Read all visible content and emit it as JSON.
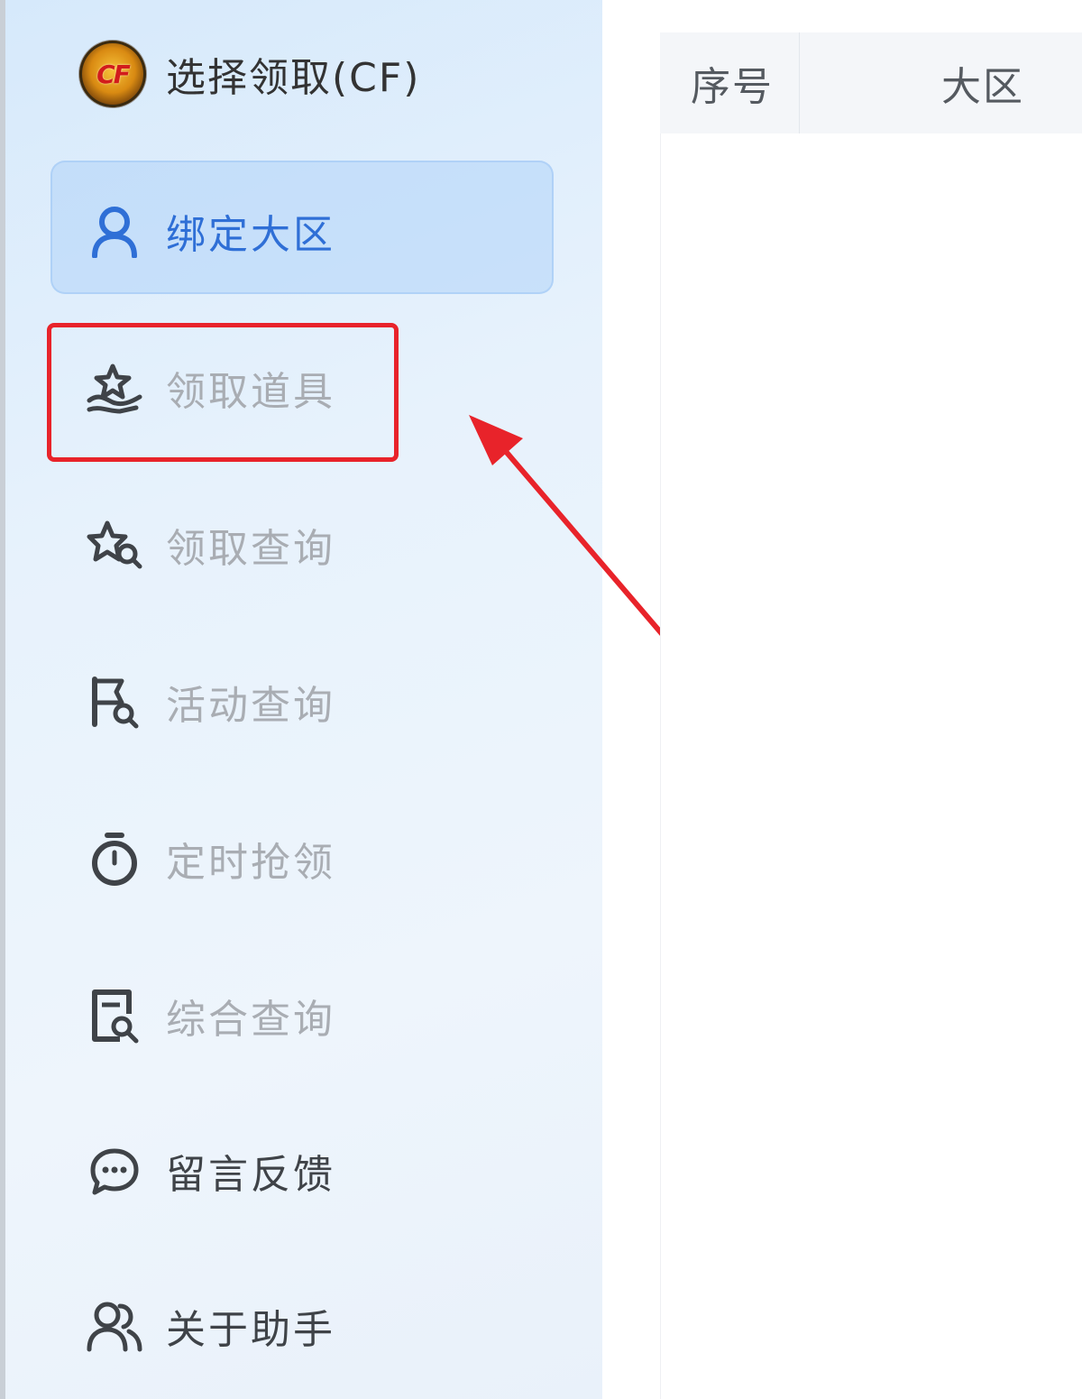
{
  "header": {
    "title": "选择领取(CF)",
    "logo_text": "CF"
  },
  "sidebar": {
    "items": [
      {
        "label": "绑定大区",
        "icon": "user-icon",
        "active": true
      },
      {
        "label": "领取道具",
        "icon": "gift-hand-icon",
        "highlighted": true
      },
      {
        "label": "领取查询",
        "icon": "star-search-icon"
      },
      {
        "label": "活动查询",
        "icon": "flag-search-icon"
      },
      {
        "label": "定时抢领",
        "icon": "stopwatch-icon"
      },
      {
        "label": "综合查询",
        "icon": "document-search-icon"
      },
      {
        "label": "留言反馈",
        "icon": "chat-bubble-icon"
      },
      {
        "label": "关于助手",
        "icon": "users-icon"
      }
    ]
  },
  "table": {
    "columns": [
      "序号",
      "大区"
    ]
  },
  "colors": {
    "active": "#2f6fd6",
    "muted": "#a9adb3",
    "dark": "#3f4348",
    "highlight": "#e8232a"
  }
}
